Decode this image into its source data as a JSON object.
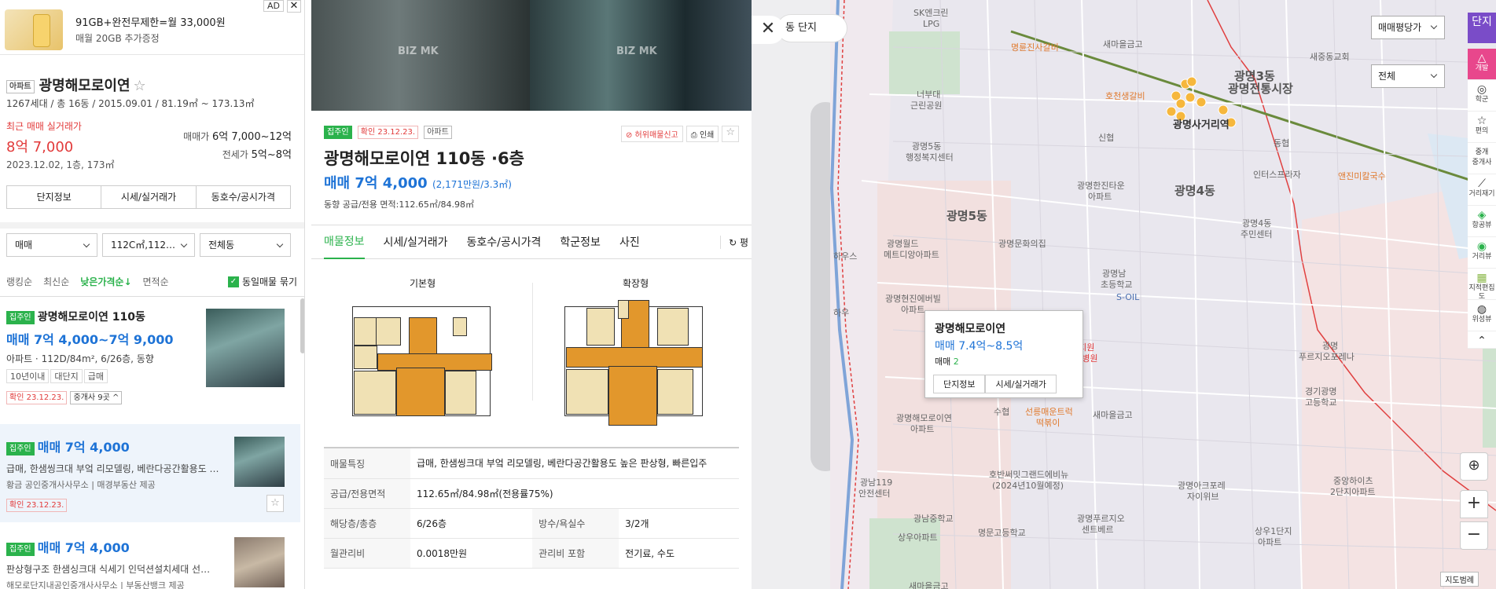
{
  "ad": {
    "title": "91GB+완전무제한=월 33,000원",
    "subtitle": "매월 20GB 추가증정",
    "badge": "AD",
    "close": "✕"
  },
  "complex": {
    "type_tag": "아파트",
    "name": "광명해모로이연",
    "info": "1267세대 / 총 16동 / 2015.09.01 / 81.19㎡ ~ 173.13㎡",
    "recent_label": "최근 매매 실거래가",
    "recent_price": "8억 7,000",
    "recent_date": "2023.12.02, 1층, 173㎡",
    "sale_label": "매매가",
    "sale_value": "6억 7,000~12억",
    "jeonse_label": "전세가",
    "jeonse_value": "5억~8억",
    "tabs": [
      "단지정보",
      "시세/실거래가",
      "동호수/공시가격"
    ]
  },
  "filters": {
    "trade": "매매",
    "area": "112C㎡,112…",
    "dong": "전체동"
  },
  "sorts": [
    "랭킹순",
    "최신순",
    "낮은가격순↓",
    "면적순"
  ],
  "group_label": "동일매물 묶기",
  "listings": [
    {
      "tag": "집주인",
      "title": "광명해모로이연 110동",
      "price": "매매 7억 4,000~7억 9,000",
      "desc": "아파트 · 112D/84m², 6/26층, 동향",
      "chips": [
        "10년이내",
        "대단지",
        "급매"
      ],
      "confirm": "확인 23.12.23.",
      "agents": "중개사 9곳 ^"
    },
    {
      "tag": "집주인",
      "price": "매매 7억 4,000",
      "desc": "급매, 한샘씽크대 부엌 리모델링, 베란다공간활용도 …",
      "agency": "황금 공인중개사사무소 | 매경부동산 제공",
      "confirm": "확인 23.12.23."
    },
    {
      "tag": "집주인",
      "price": "매매 7억 4,000",
      "desc": "판상형구조 한샘싱크대 식세기 인덕션설치세대 선…",
      "agency": "해모로단지내공인중개사사무소 | 부동산뱅크 제공"
    }
  ],
  "detail": {
    "tags": [
      "집주인",
      "확인 23.12.23.",
      "아파트"
    ],
    "report": "허위매물신고",
    "print": "인쇄",
    "title": "광명해모로이연 110동 ·6층",
    "price": "매매 7억 4,000",
    "price_per": "(2,171만원/3.3㎡)",
    "direction": "동향  공급/전용 면적:112.65㎡/84.98㎡",
    "watermark": "BIZ MK",
    "tabs": [
      "매물정보",
      "시세/실거래가",
      "동호수/공시가격",
      "학군정보",
      "사진"
    ],
    "unit_toggle": "↻ 평",
    "floorplans": [
      "기본형",
      "확장형"
    ],
    "table": {
      "feature_k": "매물특징",
      "feature_v": "급매, 한샘씽크대 부엌 리모델링, 베란다공간활용도 높은 판상형, 빠른입주",
      "area_k": "공급/전용면적",
      "area_v": "112.65㎡/84.98㎡(전용률75%)",
      "floor_k": "해당층/총층",
      "floor_v": "6/26층",
      "rooms_k": "방수/욕실수",
      "rooms_v": "3/2개",
      "fee_k": "월관리비",
      "fee_v": "0.0018만원",
      "incl_k": "관리비 포함",
      "incl_v": "전기료, 수도"
    }
  },
  "map": {
    "close": "✕",
    "pill": "동    단지",
    "price_sel": "매매평당가",
    "all_sel": "전체",
    "tools": [
      {
        "icon": "단지",
        "label": "단지",
        "color": "purple"
      },
      {
        "icon": "△",
        "label": "개발",
        "color": "pink"
      },
      {
        "icon": "◎",
        "label": "학군",
        "color": ""
      },
      {
        "icon": "☆",
        "label": "편의",
        "color": ""
      },
      {
        "icon": "중개",
        "label": "중개사",
        "color": ""
      },
      {
        "icon": "⟋",
        "label": "거리재기",
        "color": ""
      },
      {
        "icon": "◈",
        "label": "항공뷰",
        "color": ""
      },
      {
        "icon": "◉",
        "label": "거리뷰",
        "color": ""
      },
      {
        "icon": "▦",
        "label": "지적편집도",
        "color": ""
      },
      {
        "icon": "◍",
        "label": "위성뷰",
        "color": ""
      },
      {
        "icon": "⌃",
        "label": "",
        "color": ""
      }
    ],
    "labels": [
      {
        "t": "SK엔크린",
        "c": ""
      },
      {
        "t": "LPG",
        "c": ""
      },
      {
        "t": "명륜진사갈비",
        "c": "orange"
      },
      {
        "t": "새마을금고",
        "c": ""
      },
      {
        "t": "호천생갈비",
        "c": "orange"
      },
      {
        "t": "너부대",
        "c": ""
      },
      {
        "t": "근린공원",
        "c": ""
      },
      {
        "t": "신협",
        "c": ""
      },
      {
        "t": "광명3동",
        "c": "big"
      },
      {
        "t": "광명전통시장",
        "c": "big"
      },
      {
        "t": "광명사거리역",
        "c": "big"
      },
      {
        "t": "새중동교회",
        "c": ""
      },
      {
        "t": "광명5동",
        "c": ""
      },
      {
        "t": "행정복지센터",
        "c": ""
      },
      {
        "t": "동협",
        "c": ""
      },
      {
        "t": "인터스프라자",
        "c": ""
      },
      {
        "t": "앤진미칼국수",
        "c": "orange"
      },
      {
        "t": "광명한진타운",
        "c": ""
      },
      {
        "t": "아파트",
        "c": ""
      },
      {
        "t": "광명4동",
        "c": "big"
      },
      {
        "t": "광명5동",
        "c": "big"
      },
      {
        "t": "광명4동",
        "c": ""
      },
      {
        "t": "주민센터",
        "c": ""
      },
      {
        "t": "광명월드",
        "c": ""
      },
      {
        "t": "메트디앙아파트",
        "c": ""
      },
      {
        "t": "광명문화의집",
        "c": ""
      },
      {
        "t": "광명남",
        "c": ""
      },
      {
        "t": "초등학교",
        "c": ""
      },
      {
        "t": "광명현진에버빌",
        "c": ""
      },
      {
        "t": "아파트",
        "c": ""
      },
      {
        "t": "S-OIL",
        "c": "blue"
      },
      {
        "t": "예지원",
        "c": "red"
      },
      {
        "t": "요양병원",
        "c": "red"
      },
      {
        "t": "광명",
        "c": ""
      },
      {
        "t": "푸르지오포레나",
        "c": ""
      },
      {
        "t": "광명해모로이연",
        "c": ""
      },
      {
        "t": "아파트",
        "c": ""
      },
      {
        "t": "수협",
        "c": ""
      },
      {
        "t": "선릉매운트럭",
        "c": "orange"
      },
      {
        "t": "떡볶이",
        "c": "orange"
      },
      {
        "t": "새마을금고",
        "c": ""
      },
      {
        "t": "경기광명",
        "c": ""
      },
      {
        "t": "고등학교",
        "c": ""
      },
      {
        "t": "광남119",
        "c": ""
      },
      {
        "t": "안전센터",
        "c": ""
      },
      {
        "t": "호반써밋그랜드에비뉴",
        "c": ""
      },
      {
        "t": "(2024년10월예정)",
        "c": ""
      },
      {
        "t": "광명아크포레",
        "c": ""
      },
      {
        "t": "자이위브",
        "c": ""
      },
      {
        "t": "중앙하이츠",
        "c": ""
      },
      {
        "t": "2단지아파트",
        "c": ""
      },
      {
        "t": "광남중학교",
        "c": ""
      },
      {
        "t": "광명푸르지오",
        "c": ""
      },
      {
        "t": "센트베르",
        "c": ""
      },
      {
        "t": "명문고등학교",
        "c": ""
      },
      {
        "t": "상우아파트",
        "c": ""
      },
      {
        "t": "상우1단지",
        "c": ""
      },
      {
        "t": "아파트",
        "c": ""
      },
      {
        "t": "새마을금고",
        "c": ""
      },
      {
        "t": "하우스",
        "c": ""
      },
      {
        "t": "하우",
        "c": ""
      }
    ],
    "popup": {
      "name": "광명해모로이연",
      "price": "매매 7.4억~8.5억",
      "count_label": "매매",
      "count": "2",
      "btn1": "단지정보",
      "btn2": "시세/실거래가"
    },
    "zoom_in": "+",
    "zoom_out": "−",
    "locate": "⊕",
    "legend": "지도범례"
  }
}
